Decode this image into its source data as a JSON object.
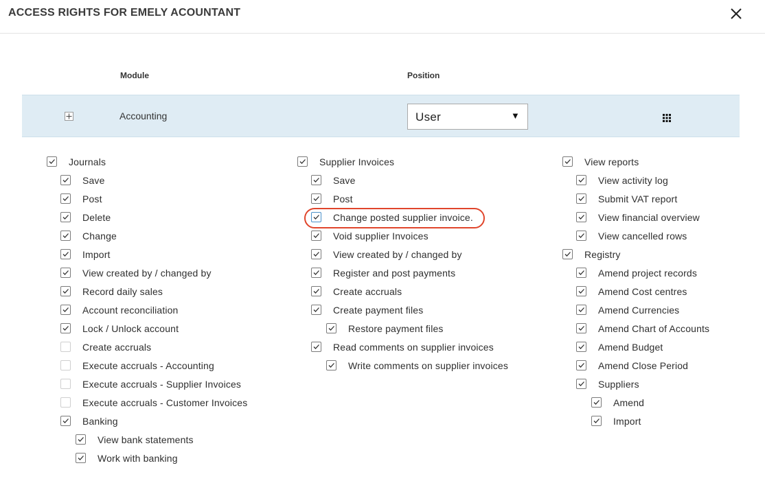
{
  "dialog": {
    "title": "ACCESS RIGHTS FOR EMELY ACOUNTANT",
    "close_icon": "close-icon"
  },
  "table": {
    "module_header": "Module",
    "position_header": "Position"
  },
  "module_row": {
    "name": "Accounting",
    "expand_icon": "plus-icon",
    "position_value": "User",
    "position_arrow": "▼",
    "menu_icon": "grid-icon",
    "row_color": "#dfecf4"
  },
  "columns": [
    {
      "items": [
        {
          "label": "Journals",
          "checked": true,
          "level": 0
        },
        {
          "label": "Save",
          "checked": true,
          "level": 1
        },
        {
          "label": "Post",
          "checked": true,
          "level": 1
        },
        {
          "label": "Delete",
          "checked": true,
          "level": 1
        },
        {
          "label": "Change",
          "checked": true,
          "level": 1
        },
        {
          "label": "Import",
          "checked": true,
          "level": 1
        },
        {
          "label": "View created by / changed by",
          "checked": true,
          "level": 1
        },
        {
          "label": "Record daily sales",
          "checked": true,
          "level": 1
        },
        {
          "label": "Account reconciliation",
          "checked": true,
          "level": 1
        },
        {
          "label": "Lock / Unlock account",
          "checked": true,
          "level": 1
        },
        {
          "label": "Create accruals",
          "checked": false,
          "level": 1
        },
        {
          "label": "Execute accruals - Accounting",
          "checked": false,
          "level": 1
        },
        {
          "label": "Execute accruals - Supplier Invoices",
          "checked": false,
          "level": 1
        },
        {
          "label": "Execute accruals - Customer Invoices",
          "checked": false,
          "level": 1
        },
        {
          "label": "Banking",
          "checked": true,
          "level": 1
        },
        {
          "label": "View bank statements",
          "checked": true,
          "level": 2
        },
        {
          "label": "Work with banking",
          "checked": true,
          "level": 2
        }
      ]
    },
    {
      "items": [
        {
          "label": "Supplier Invoices",
          "checked": true,
          "level": 0
        },
        {
          "label": "Save",
          "checked": true,
          "level": 1
        },
        {
          "label": "Post",
          "checked": true,
          "level": 1
        },
        {
          "label": "Change posted supplier invoice.",
          "checked": true,
          "level": 1,
          "highlighted": true
        },
        {
          "label": "Void supplier Invoices",
          "checked": true,
          "level": 1
        },
        {
          "label": "View created by / changed by",
          "checked": true,
          "level": 1
        },
        {
          "label": "Register and post payments",
          "checked": true,
          "level": 1
        },
        {
          "label": "Create accruals",
          "checked": true,
          "level": 1
        },
        {
          "label": "Create payment files",
          "checked": true,
          "level": 1
        },
        {
          "label": "Restore payment files",
          "checked": true,
          "level": 2
        },
        {
          "label": "Read comments on supplier invoices",
          "checked": true,
          "level": 1
        },
        {
          "label": "Write comments on supplier invoices",
          "checked": true,
          "level": 2
        }
      ]
    },
    {
      "items": [
        {
          "label": "View reports",
          "checked": true,
          "level": 0
        },
        {
          "label": "View activity log",
          "checked": true,
          "level": 1
        },
        {
          "label": "Submit VAT report",
          "checked": true,
          "level": 1
        },
        {
          "label": "View financial overview",
          "checked": true,
          "level": 1
        },
        {
          "label": "View cancelled rows",
          "checked": true,
          "level": 1
        },
        {
          "label": "Registry",
          "checked": true,
          "level": 0
        },
        {
          "label": "Amend project records",
          "checked": true,
          "level": 1
        },
        {
          "label": "Amend Cost centres",
          "checked": true,
          "level": 1
        },
        {
          "label": "Amend Currencies",
          "checked": true,
          "level": 1
        },
        {
          "label": "Amend Chart of Accounts",
          "checked": true,
          "level": 1
        },
        {
          "label": "Amend Budget",
          "checked": true,
          "level": 1
        },
        {
          "label": "Amend Close Period",
          "checked": true,
          "level": 1
        },
        {
          "label": "Suppliers",
          "checked": true,
          "level": 1
        },
        {
          "label": "Amend",
          "checked": true,
          "level": 2
        },
        {
          "label": "Import",
          "checked": true,
          "level": 2
        }
      ]
    }
  ],
  "highlight_color": "#e0452b"
}
